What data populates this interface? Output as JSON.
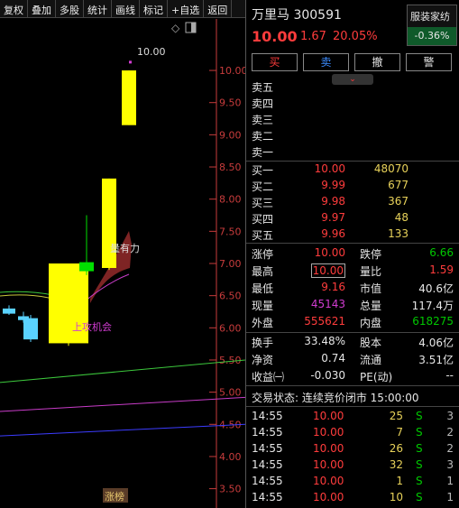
{
  "toolbar": {
    "items": [
      "复权",
      "叠加",
      "多股",
      "统计",
      "画线",
      "标记",
      "+自选",
      "返回"
    ]
  },
  "chart": {
    "price_axis": [
      "10.00",
      "9.50",
      "9.00",
      "8.50",
      "8.00",
      "7.50",
      "7.00",
      "6.50",
      "6.00",
      "5.50",
      "5.00",
      "4.50",
      "4.00",
      "3.50"
    ],
    "annotation_high": "10.00",
    "annotation_1": "量有力",
    "annotation_2": "上攻机会",
    "bottom_badge": "涨榜"
  },
  "chart_data": {
    "type": "candlestick",
    "y_range": [
      3.2,
      10.8
    ],
    "candles": [
      {
        "o": 6.3,
        "h": 6.35,
        "l": 6.2,
        "c": 6.22,
        "color": "cyan"
      },
      {
        "o": 6.18,
        "h": 6.25,
        "l": 6.08,
        "c": 6.12,
        "color": "cyan"
      },
      {
        "o": 6.15,
        "h": 6.2,
        "l": 5.78,
        "c": 5.82,
        "color": "cyan"
      },
      {
        "o": 5.76,
        "h": 7.0,
        "l": 5.72,
        "c": 7.0,
        "color": "yellow"
      },
      {
        "o": 7.02,
        "h": 7.75,
        "l": 6.82,
        "c": 6.88,
        "color": "green"
      },
      {
        "o": 6.93,
        "h": 8.32,
        "l": 6.9,
        "c": 8.32,
        "color": "yellow"
      },
      {
        "o": 9.15,
        "h": 10.0,
        "l": 9.15,
        "c": 10.0,
        "color": "yellow"
      }
    ],
    "lines": [
      {
        "color": "#3cc83c",
        "points": [
          [
            0,
            5.15
          ],
          [
            272,
            5.5
          ]
        ]
      },
      {
        "color": "#c83cc8",
        "points": [
          [
            0,
            4.7
          ],
          [
            272,
            4.92
          ]
        ]
      },
      {
        "color": "#3c3cff",
        "points": [
          [
            0,
            4.32
          ],
          [
            272,
            4.5
          ]
        ]
      }
    ]
  },
  "header": {
    "name_code": "万里马 300591",
    "sector": "服装家纺",
    "price": "10.00",
    "change": "1.67",
    "pct": "20.05%",
    "sector_pct": "-0.36%"
  },
  "buttons": {
    "buy": "买",
    "sell": "卖",
    "cancel": "撤",
    "alert": "警"
  },
  "sells": [
    {
      "label": "卖五"
    },
    {
      "label": "卖四"
    },
    {
      "label": "卖三"
    },
    {
      "label": "卖二"
    },
    {
      "label": "卖一"
    }
  ],
  "buys": [
    {
      "label": "买一",
      "price": "10.00",
      "vol": "48070"
    },
    {
      "label": "买二",
      "price": "9.99",
      "vol": "677"
    },
    {
      "label": "买三",
      "price": "9.98",
      "vol": "367"
    },
    {
      "label": "买四",
      "price": "9.97",
      "vol": "48"
    },
    {
      "label": "买五",
      "price": "9.96",
      "vol": "133"
    }
  ],
  "stats": [
    {
      "l1": "涨停",
      "v1": "10.00",
      "l2": "跌停",
      "v2": "6.66"
    },
    {
      "l1": "最高",
      "v1": "10.00",
      "l2": "量比",
      "v2": "1.59"
    },
    {
      "l1": "最低",
      "v1": "9.16",
      "l2": "市值",
      "v2": "40.6亿"
    },
    {
      "l1": "现量",
      "v1": "45143",
      "l2": "总量",
      "v2": "117.4万"
    },
    {
      "l1": "外盘",
      "v1": "555621",
      "l2": "内盘",
      "v2": "618275"
    }
  ],
  "stats2": [
    {
      "l1": "换手",
      "v1": "33.48%",
      "l2": "股本",
      "v2": "4.06亿"
    },
    {
      "l1": "净资",
      "v1": "0.74",
      "l2": "流通",
      "v2": "3.51亿"
    },
    {
      "l1": "收益㈠",
      "v1": "-0.030",
      "l2": "PE(动)",
      "v2": "--"
    }
  ],
  "status": "交易状态: 连续竞价闭市 15:00:00",
  "ticks": [
    {
      "time": "14:55",
      "price": "10.00",
      "vol": "25",
      "side": "S",
      "n": "3"
    },
    {
      "time": "14:55",
      "price": "10.00",
      "vol": "7",
      "side": "S",
      "n": "2"
    },
    {
      "time": "14:55",
      "price": "10.00",
      "vol": "26",
      "side": "S",
      "n": "2"
    },
    {
      "time": "14:55",
      "price": "10.00",
      "vol": "32",
      "side": "S",
      "n": "3"
    },
    {
      "time": "14:55",
      "price": "10.00",
      "vol": "1",
      "side": "S",
      "n": "1"
    },
    {
      "time": "14:55",
      "price": "10.00",
      "vol": "10",
      "side": "S",
      "n": "1"
    }
  ]
}
